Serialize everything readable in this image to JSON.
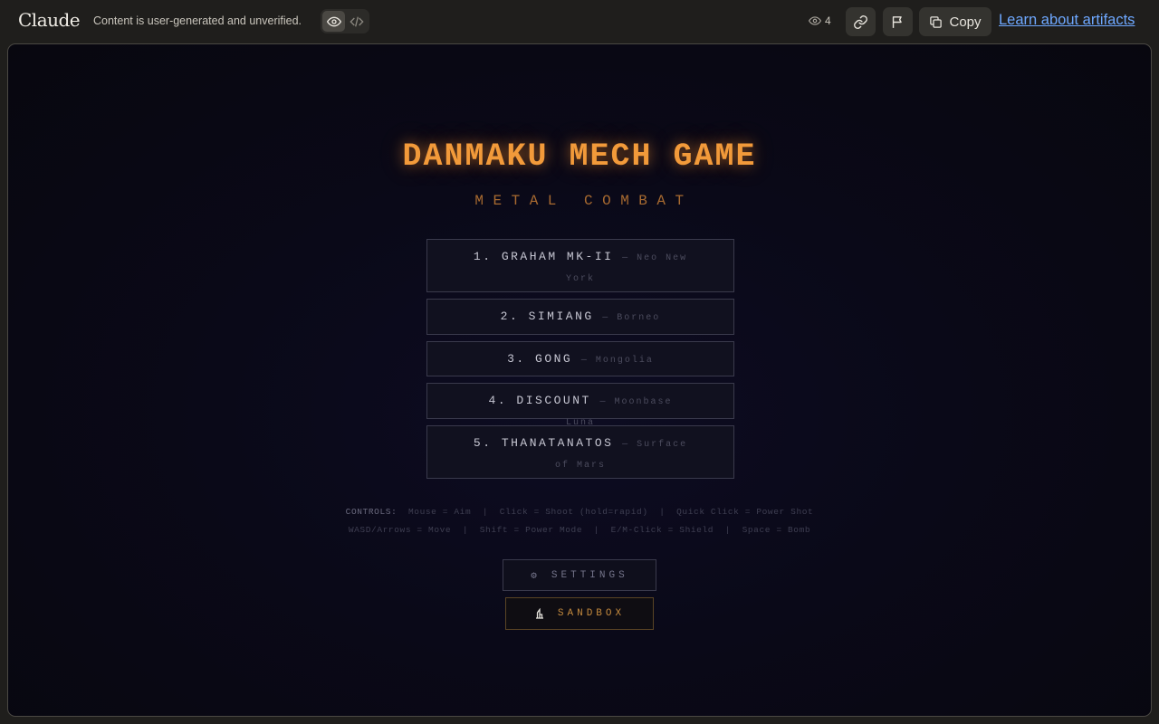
{
  "topbar": {
    "brand": "Claude",
    "notice": "Content is user-generated and unverified.",
    "view_count": "4",
    "copy_label": "Copy",
    "learn_link": "Learn about artifacts"
  },
  "game": {
    "title": "DANMAKU MECH GAME",
    "subtitle": "METAL COMBAT",
    "mechs": [
      {
        "name": "1. GRAHAM MK-II",
        "location": "— Neo New York"
      },
      {
        "name": "2. SIMIANG",
        "location": "— Borneo"
      },
      {
        "name": "3. GONG",
        "location": "— Mongolia"
      },
      {
        "name": "4. DISCOUNT",
        "location": "— Moonbase Luna"
      },
      {
        "name": "5. THANATANATOS",
        "location": "— Surface of Mars"
      }
    ],
    "controls": {
      "label": "CONTROLS:",
      "line1": "  Mouse = Aim  |  Click = Shoot (hold=rapid)  |  Quick Click = Power Shot",
      "line2": "WASD/Arrows = Move  |  Shift = Power Mode  |  E/M-Click = Shield  |  Space = Bomb"
    },
    "settings_label": "SETTINGS",
    "sandbox_label": "SANDBOX"
  },
  "colors": {
    "accent": "#f29a3a",
    "link": "#6ea8ff",
    "background": "#0a0918"
  }
}
